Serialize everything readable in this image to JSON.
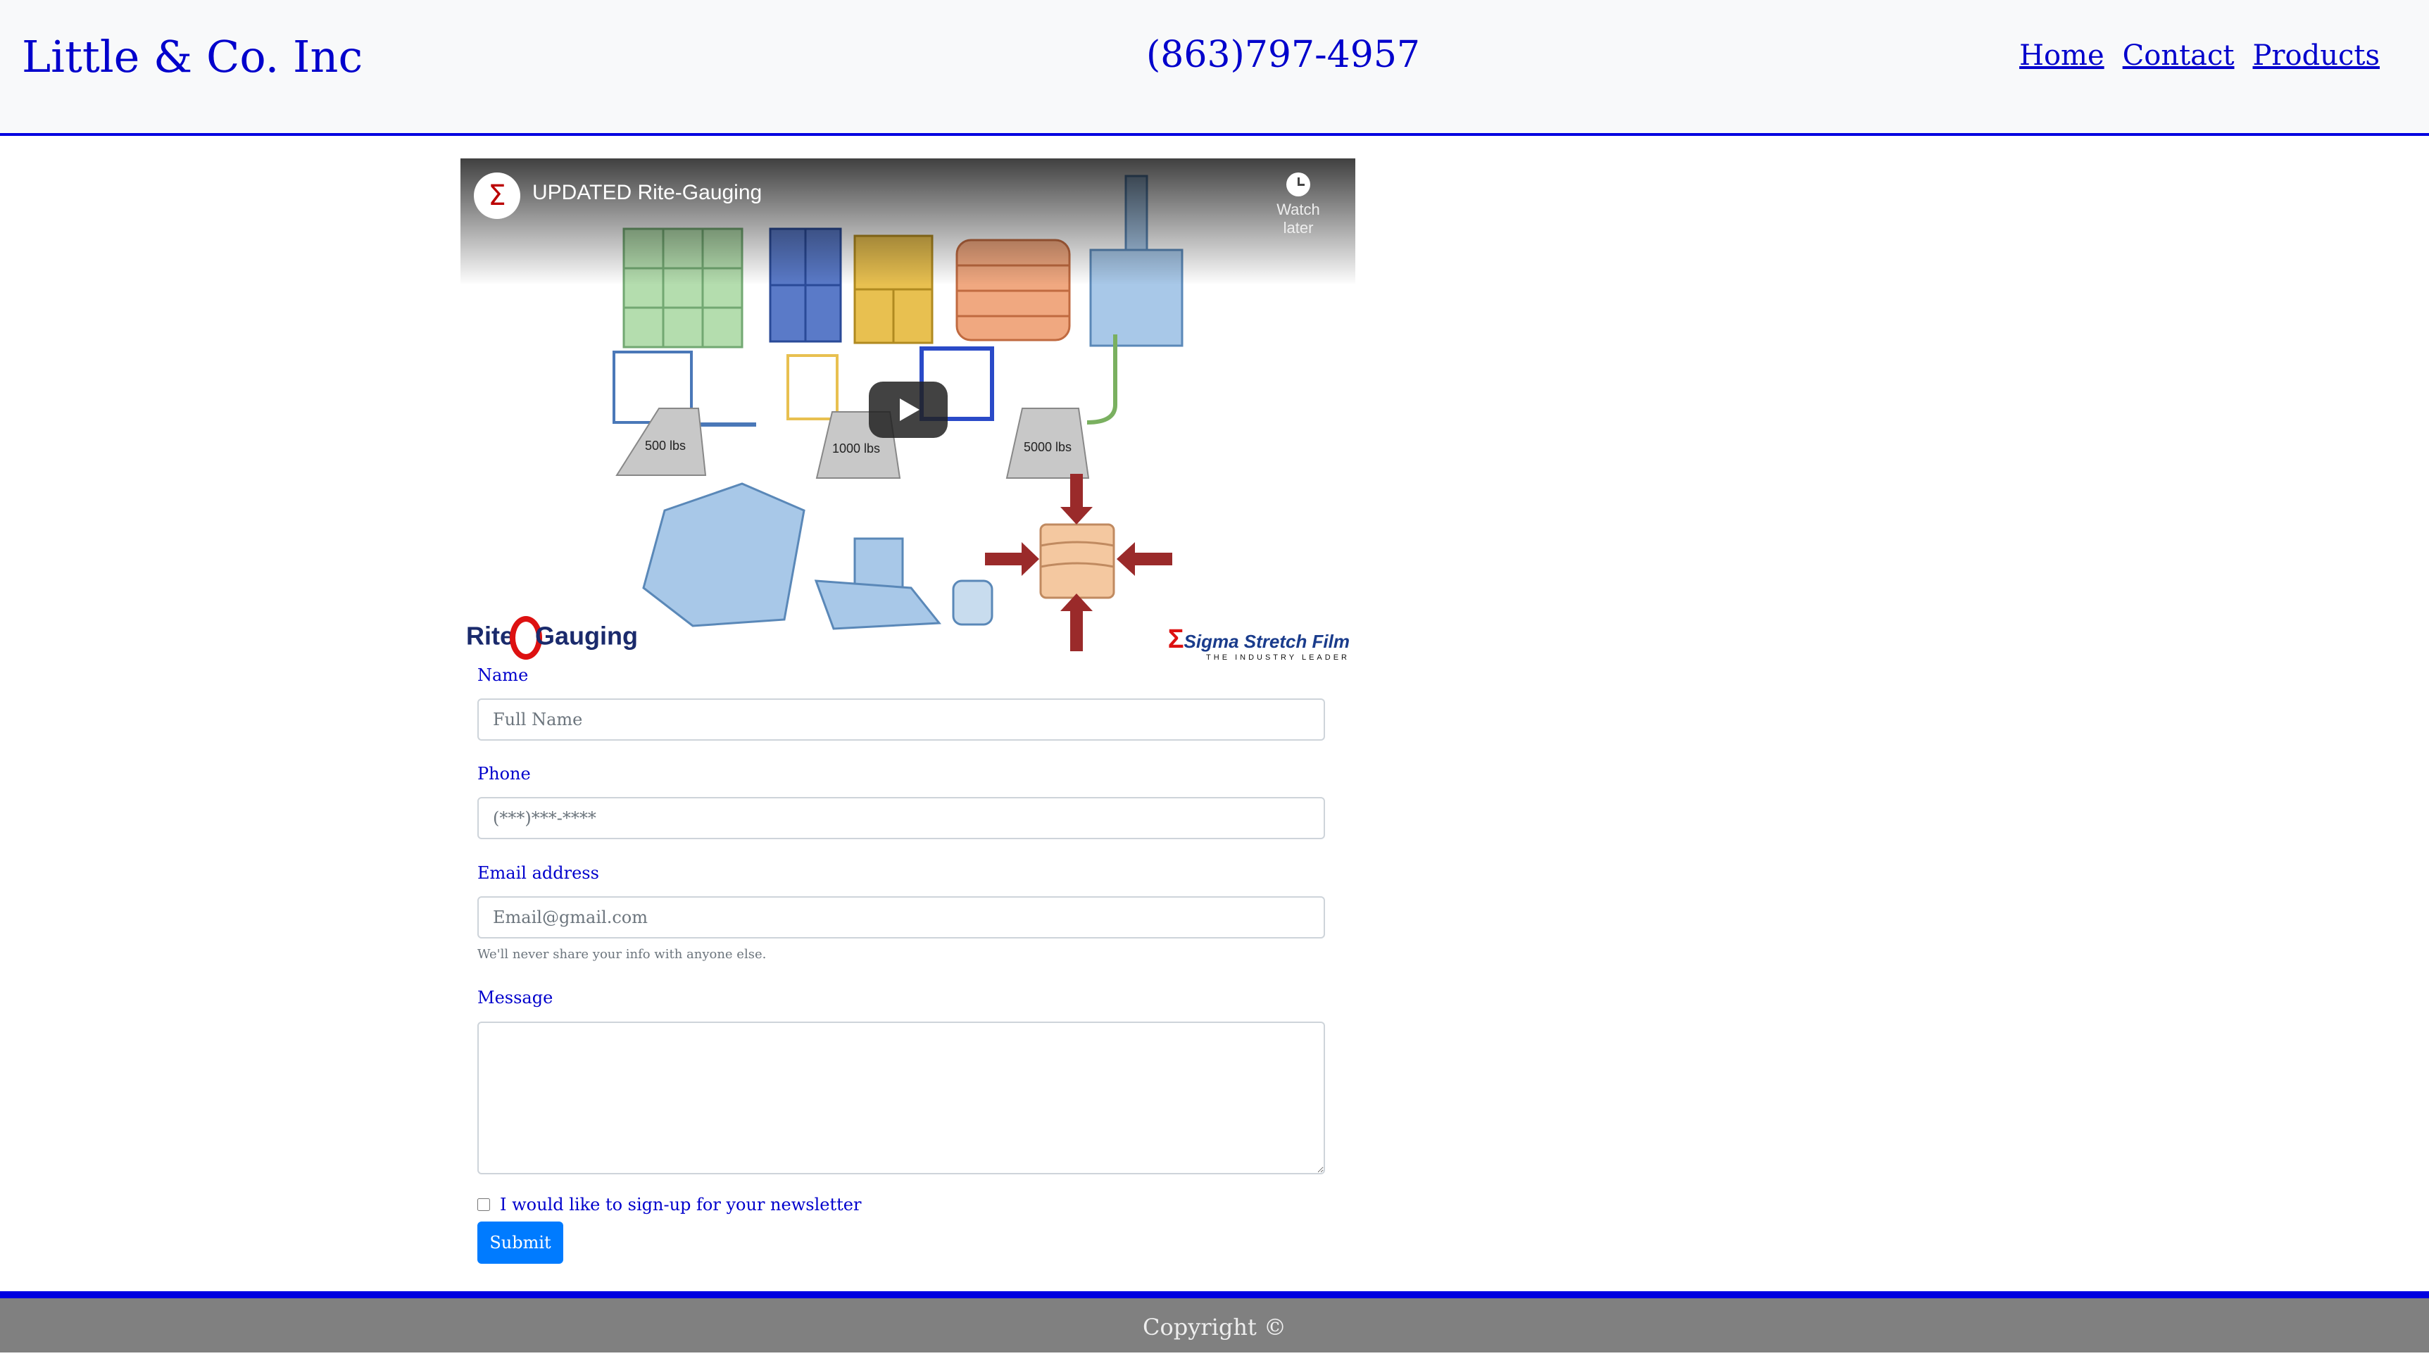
{
  "header": {
    "brand": "Little & Co. Inc",
    "phone": "(863)797-4957",
    "nav": [
      "Home",
      "Contact",
      "Products"
    ]
  },
  "video": {
    "channel_icon": "Σ",
    "title": "UPDATED Rite-Gauging",
    "watch_later": "Watch later",
    "play_icon": "play-icon",
    "weights": [
      "500 lbs",
      "1000 lbs",
      "5000 lbs"
    ],
    "logo_left": {
      "before": "Rite",
      "after": "Gauging"
    },
    "logo_right": {
      "name": "Sigma Stretch Film",
      "tagline": "THE INDUSTRY LEADER"
    }
  },
  "form": {
    "name_label": "Name",
    "name_placeholder": "Full Name",
    "phone_label": "Phone",
    "phone_placeholder": "(***)***-****",
    "email_label": "Email address",
    "email_placeholder": "Email@gmail.com",
    "email_help": "We'll never share your info with anyone else.",
    "message_label": "Message",
    "message_value": "",
    "newsletter_label": "I would like to sign-up for your newsletter",
    "newsletter_checked": false,
    "submit_label": "Submit"
  },
  "footer": {
    "copyright": "Copyright ©"
  },
  "colors": {
    "accent": "#0000cc",
    "header_bg": "#f8f9fa",
    "footer_bg": "#808080",
    "button": "#007bff"
  }
}
